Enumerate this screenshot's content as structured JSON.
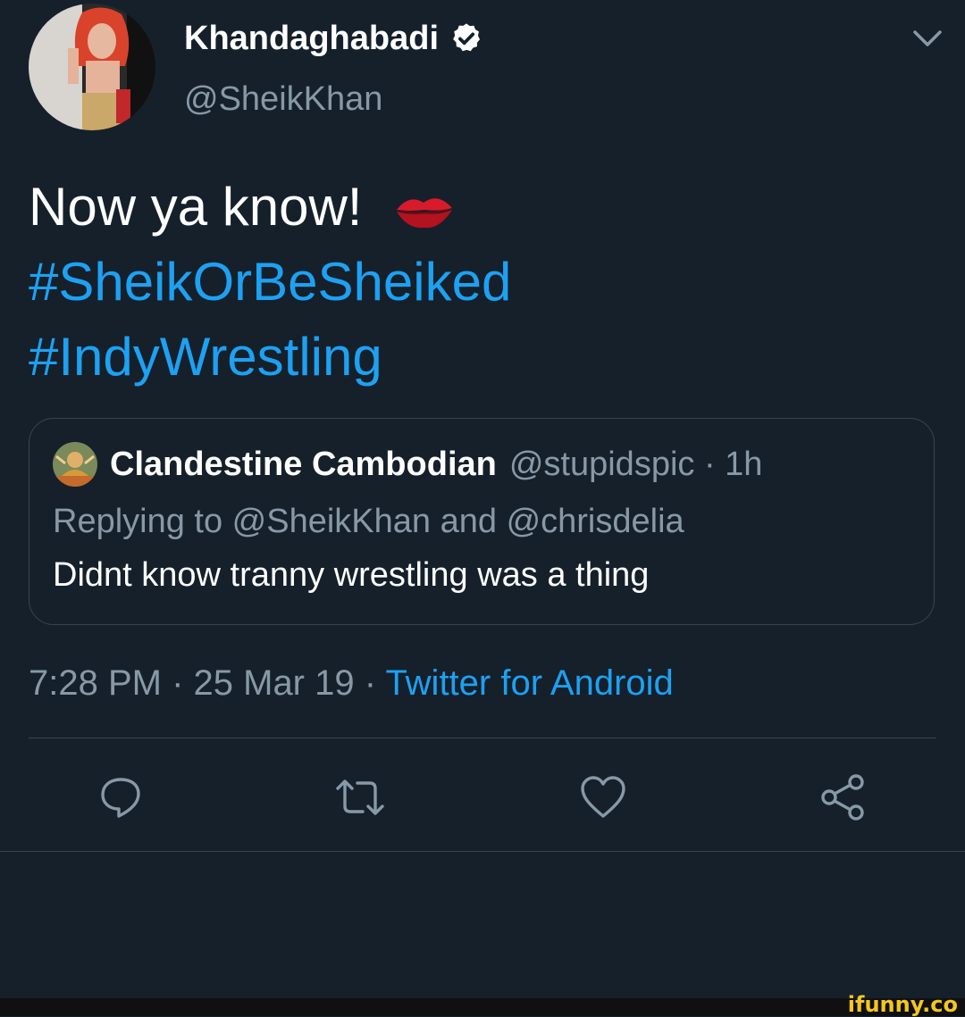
{
  "author": {
    "display_name": "Khandaghabadi",
    "handle": "@SheikKhan",
    "verified": true
  },
  "tweet": {
    "text": "Now ya know!",
    "hashtags": [
      "#SheikOrBeSheiked",
      "#IndyWrestling"
    ]
  },
  "quoted_tweet": {
    "name": "Clandestine Cambodian",
    "handle_time": "@stupidspic · 1h",
    "replying_label": "Replying to @SheikKhan and @chrisdelia",
    "text": "Didnt know tranny wrestling was a thing"
  },
  "meta": {
    "timestamp": "7:28 PM · 25 Mar 19 · ",
    "source": "Twitter for Android"
  },
  "colors": {
    "background": "#15202b",
    "link": "#1da1f2",
    "muted": "#8899a6",
    "border": "#38444d"
  },
  "actions": [
    "reply-icon",
    "retweet-icon",
    "like-icon",
    "share-icon"
  ],
  "watermark": "ifunny.co"
}
